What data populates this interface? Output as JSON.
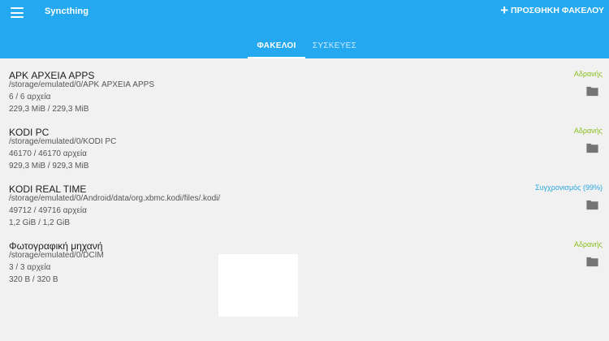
{
  "app": {
    "title": "Syncthing",
    "add_folder_label": "ΠΡΟΣΘΗΚΗ ΦΑΚΕΛΟΥ",
    "accent": "#24a8f0"
  },
  "tabs": [
    {
      "label": "ΦΑΚΕΛΟΙ",
      "active": true
    },
    {
      "label": "ΣΥΣΚΕΥΕΣ",
      "active": false
    }
  ],
  "folders": [
    {
      "name": "APK ΑΡΧΕΙΑ APPS",
      "path": "/storage/emulated/0/APK ΑΡΧΕΙΑ APPS",
      "files": "6 / 6 αρχεία",
      "size": "229,3 MiB / 229,3 MiB",
      "status": "Αδρανής",
      "status_color": "#8bbf1a",
      "icon": "folder-icon"
    },
    {
      "name": "KODI PC",
      "path": "/storage/emulated/0/KODI PC",
      "files": "46170 / 46170 αρχεία",
      "size": "929,3 MiB / 929,3 MiB",
      "status": "Αδρανής",
      "status_color": "#8bbf1a",
      "icon": "folder-icon"
    },
    {
      "name": "KODI REAL TIME",
      "path": "/storage/emulated/0/Android/data/org.xbmc.kodi/files/.kodi/",
      "files": "49712 / 49716 αρχεία",
      "size": "1,2 GiB / 1,2 GiB",
      "status": "Συγχρονισμός (99%)",
      "status_color": "#29a8e0",
      "icon": "folder-icon"
    },
    {
      "name": "Φωτογραφική μηχανή",
      "path": "/storage/emulated/0/DCIM",
      "files": "3 / 3 αρχεία",
      "size": "320 B / 320 B",
      "status": "Αδρανής",
      "status_color": "#8bbf1a",
      "icon": "folder-icon"
    }
  ]
}
